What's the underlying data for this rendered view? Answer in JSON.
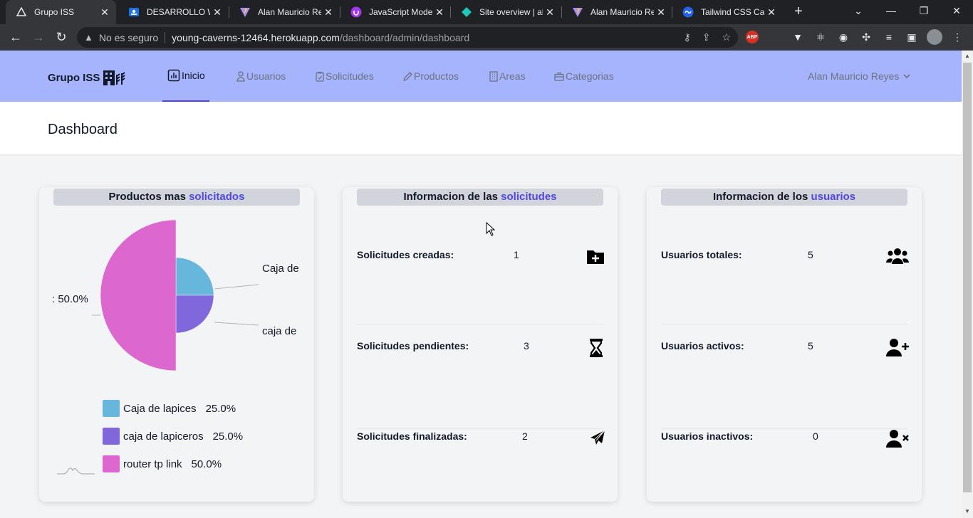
{
  "browser": {
    "tabs": [
      {
        "title": "Grupo ISS",
        "active": true,
        "icon": "herokuapp-icon"
      },
      {
        "title": "DESARROLLO WEB",
        "active": false,
        "icon": "classroom-icon"
      },
      {
        "title": "Alan Mauricio Reyes",
        "active": false,
        "icon": "vite-icon"
      },
      {
        "title": "JavaScript Moderno",
        "active": false,
        "icon": "udemy-icon"
      },
      {
        "title": "Site overview | alan",
        "active": false,
        "icon": "netlify-icon"
      },
      {
        "title": "Alan Mauricio Reyes",
        "active": false,
        "icon": "vite-icon"
      },
      {
        "title": "Tailwind CSS Cards",
        "active": false,
        "icon": "tailwind-icon"
      }
    ],
    "url_warning": "No es seguro",
    "url_host": "young-caverns-12464.herokuapp.com",
    "url_path": "/dashboard/admin/dashboard"
  },
  "app": {
    "brand": "Grupo ISS",
    "nav": [
      {
        "label": "Inicio",
        "icon": "chart-icon",
        "active": true
      },
      {
        "label": "Usuarios",
        "icon": "user-icon",
        "active": false
      },
      {
        "label": "Solicitudes",
        "icon": "clipboard-icon",
        "active": false
      },
      {
        "label": "Productos",
        "icon": "pencil-icon",
        "active": false
      },
      {
        "label": "Areas",
        "icon": "building-icon",
        "active": false
      },
      {
        "label": "Categorias",
        "icon": "briefcase-icon",
        "active": false
      }
    ],
    "user_name": "Alan Mauricio Reyes",
    "page_title": "Dashboard"
  },
  "cards": {
    "products": {
      "title_prefix": "Productos mas ",
      "title_highlight": "solicitados"
    },
    "requests": {
      "title_prefix": "Informacion de las ",
      "title_highlight": "solicitudes",
      "stats": [
        {
          "label": "Solicitudes creadas:",
          "value": "1",
          "icon": "folder-plus-icon"
        },
        {
          "label": "Solicitudes pendientes:",
          "value": "3",
          "icon": "hourglass-icon"
        },
        {
          "label": "Solicitudes finalizadas:",
          "value": "2",
          "icon": "paper-plane-icon"
        }
      ]
    },
    "users": {
      "title_prefix": "Informacion de los ",
      "title_highlight": "usuarios",
      "stats": [
        {
          "label": "Usuarios totales:",
          "value": "5",
          "icon": "users-icon"
        },
        {
          "label": "Usuarios activos:",
          "value": "5",
          "icon": "user-plus-icon"
        },
        {
          "label": "Usuarios inactivos:",
          "value": "0",
          "icon": "user-x-icon"
        }
      ]
    }
  },
  "chart_data": {
    "type": "pie",
    "title": "",
    "slices": [
      {
        "label": "Caja de lapices",
        "value": 25.0,
        "pct_label": "25.0%",
        "color": "#67b6dc"
      },
      {
        "label": "caja de lapiceros",
        "value": 25.0,
        "pct_label": "25.0%",
        "color": "#8067dc"
      },
      {
        "label": "router tp link",
        "value": 50.0,
        "pct_label": "50.0%",
        "color": "#dc67ce"
      }
    ],
    "outer_labels": {
      "slice1": "Caja de",
      "slice2": "caja de",
      "slice3": ": 50.0%"
    },
    "legend_position": "bottom"
  }
}
